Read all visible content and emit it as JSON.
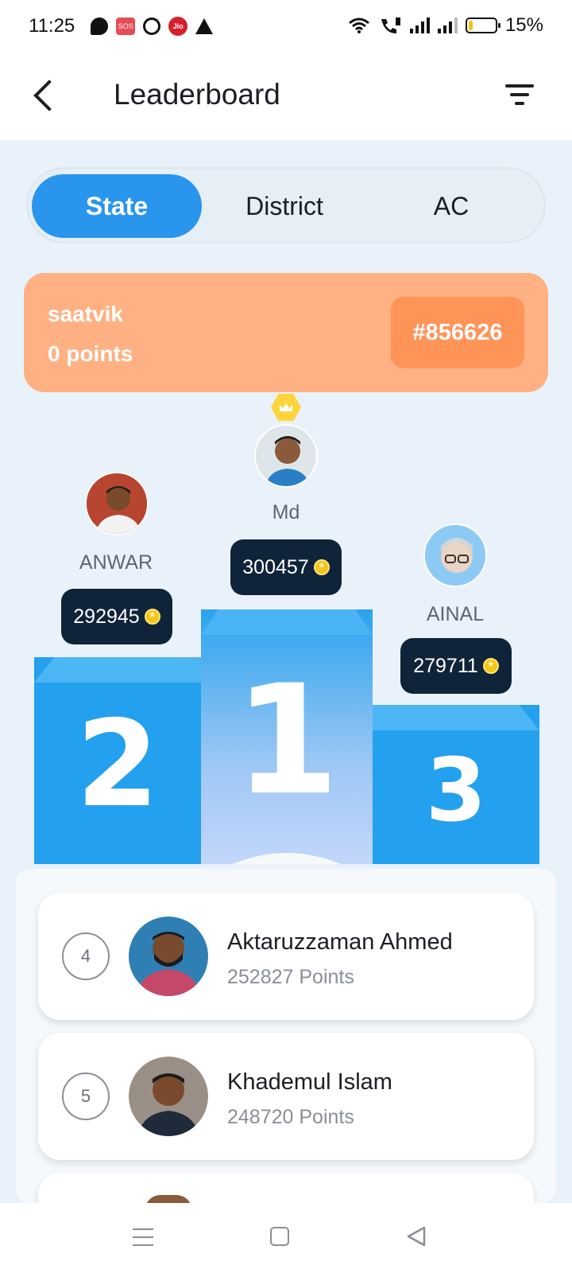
{
  "status_bar": {
    "time": "11:25",
    "sos_label": "SOS",
    "jio_label": "Jio",
    "battery": "15%",
    "battery_level": 0.15,
    "icons": [
      "chat-icon",
      "sos-icon",
      "alarm-icon",
      "jio-icon",
      "warning-icon",
      "wifi-icon",
      "volte-call-icon",
      "signal-icon",
      "battery-icon"
    ]
  },
  "header": {
    "title": "Leaderboard",
    "back_icon": "back-arrow-icon",
    "filter_icon": "filter-icon"
  },
  "tabs": [
    {
      "label": "State",
      "active": true
    },
    {
      "label": "District",
      "active": false
    },
    {
      "label": "AC",
      "active": false
    }
  ],
  "my_card": {
    "name": "saatvik",
    "points": "0 points",
    "rank": "#856626"
  },
  "podium": {
    "first": {
      "name": "Md",
      "score": "300457",
      "place": "1"
    },
    "second": {
      "name": "ANWAR",
      "score": "292945",
      "place": "2"
    },
    "third": {
      "name": "AINAL",
      "score": "279711",
      "place": "3"
    }
  },
  "list": [
    {
      "rank": "4",
      "name": "Aktaruzzaman Ahmed",
      "points": "252827 Points"
    },
    {
      "rank": "5",
      "name": "Khademul Islam",
      "points": "248720 Points"
    }
  ],
  "colors": {
    "accent": "#2a95ec",
    "my_card_bg": "#ffb183",
    "rank_badge": "#ff9458",
    "score_badge": "#0f2438",
    "podium_blue": "#29a0ee"
  }
}
